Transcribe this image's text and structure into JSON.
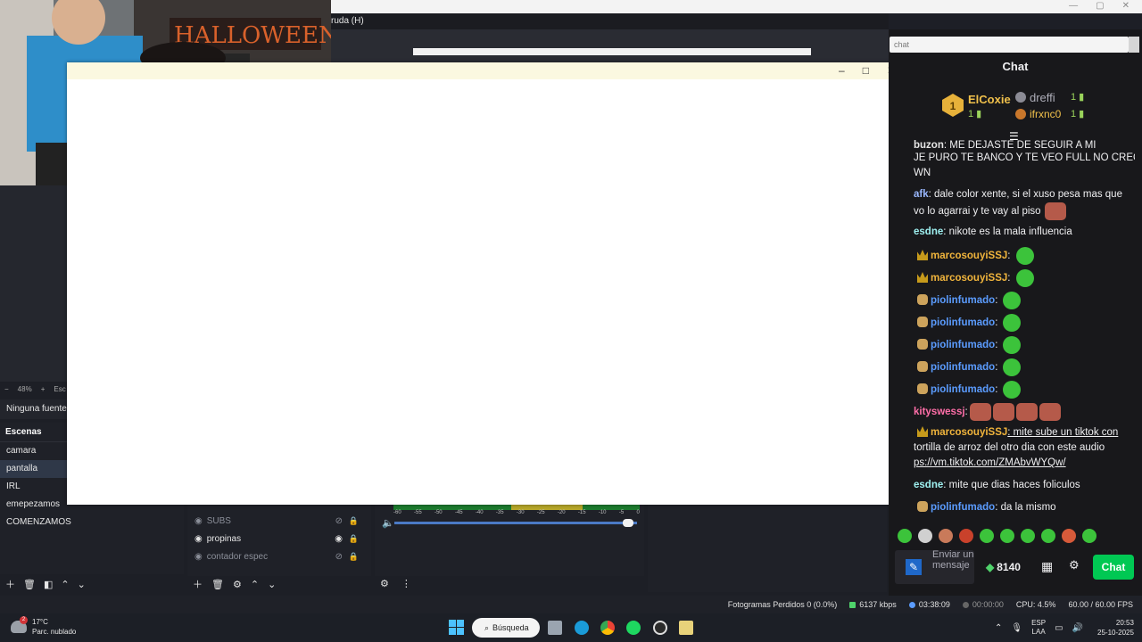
{
  "window": {
    "obs_menu_help": "ruda (H)",
    "popup_controls": {
      "minimize": "–",
      "maximize": "□",
      "close": "✕"
    },
    "titlebar_controls": {
      "minimize": "—",
      "maximize": "▢",
      "close": "✕"
    }
  },
  "obs": {
    "zoom": {
      "minus": "−",
      "value": "48%",
      "plus": "+",
      "extra": "Esc"
    },
    "no_source": "Ninguna fuente s",
    "scenes": {
      "title": "Escenas",
      "items": [
        "camara",
        "pantalla",
        "IRL",
        "emepezamos",
        "COMENZAMOS"
      ],
      "active": "pantalla"
    },
    "sources": [
      {
        "label": "SUBS",
        "dim": true
      },
      {
        "label": "propinas",
        "dim": false
      },
      {
        "label": "contador espec",
        "dim": true
      }
    ],
    "mixer_ticks": [
      "-60",
      "-55",
      "-50",
      "-45",
      "-40",
      "-35",
      "-30",
      "-25",
      "-20",
      "-15",
      "-10",
      "-5",
      "0"
    ],
    "mixer_level_fraction": 0.97,
    "status": {
      "dropped": "Fotogramas Perdidos 0 (0.0%)",
      "bitrate": "6137 kbps",
      "live_time": "03:38:09",
      "rec_time": "00:00:00",
      "cpu": "CPU: 4.5%",
      "fps": "60.00 / 60.00 FPS"
    }
  },
  "chat": {
    "url_bar": "chat",
    "title": "Chat",
    "leaderboard": [
      {
        "rank": "1",
        "name": "ElCoxie",
        "count": "1"
      },
      {
        "rank": "2",
        "name": "dreffi",
        "count": "1"
      },
      {
        "rank": "3",
        "name": "ifrxnc0",
        "count": "1"
      }
    ],
    "messages": [
      {
        "user": "buzon",
        "text": ": ME DEJASTE DE SEGUIR A MI",
        "user_color": "#e6e6e6"
      },
      {
        "user": "",
        "text": "JE PURO TE BANCO Y TE VEO FULL NO CREO",
        "user_color": "#e6e6e6"
      },
      {
        "user": "",
        "text": "WN",
        "user_color": "#e6e6e6"
      },
      {
        "user": "afk",
        "text": ": dale color xente, si el xuso pesa mas que",
        "user_color": "#9ab8ff"
      },
      {
        "user": "",
        "text": "vo lo agarrai y te vay al piso",
        "user_color": "#e6e6e6"
      },
      {
        "user": "esdne",
        "text": ": nikote es la mala influencia",
        "user_color": "#9ef0f0"
      },
      {
        "user": "marcosouyiSSJ",
        "text": ":",
        "user_color": "#f0b43c"
      },
      {
        "user": "marcosouyiSSJ",
        "text": ":",
        "user_color": "#f0b43c"
      },
      {
        "user": "piolinfumado",
        "text": ":",
        "user_color": "#5b9cff"
      },
      {
        "user": "piolinfumado",
        "text": ":",
        "user_color": "#5b9cff"
      },
      {
        "user": "piolinfumado",
        "text": ":",
        "user_color": "#5b9cff"
      },
      {
        "user": "piolinfumado",
        "text": ":",
        "user_color": "#5b9cff"
      },
      {
        "user": "piolinfumado",
        "text": ":",
        "user_color": "#5b9cff"
      },
      {
        "user": "kityswessj",
        "text": ":",
        "user_color": "#ff6ea8"
      },
      {
        "user": "marcosouyiSSJ",
        "text": ": mite sube un tiktok con",
        "user_color": "#f0b43c"
      },
      {
        "user": "",
        "text": "tortilla de arroz del otro dia con este audio",
        "user_color": "#e6e6e6"
      },
      {
        "user": "",
        "text": "ps://vm.tiktok.com/ZMAbvWYQw/",
        "user_color": "#e6e6e6"
      },
      {
        "user": "esdne",
        "text": ": mite que dias haces foliculos",
        "user_color": "#9ef0f0"
      },
      {
        "user": "piolinfumado",
        "text": ": da la mismo",
        "user_color": "#5b9cff"
      }
    ],
    "send_placeholder": "Enviar un mensaje",
    "points": "8140",
    "chat_button": "Chat"
  },
  "taskbar": {
    "weather_temp": "17°C",
    "weather_desc": "Parc. nublado",
    "weather_badge": "2",
    "search": "Búsqueda",
    "lang_top": "ESP",
    "lang_bottom": "LAA",
    "time": "20:53",
    "date": "25-10-2025"
  },
  "colors": {
    "chat_button": "#00c853",
    "obs_bg": "#1f2128",
    "live_green": "#4fd36b"
  }
}
